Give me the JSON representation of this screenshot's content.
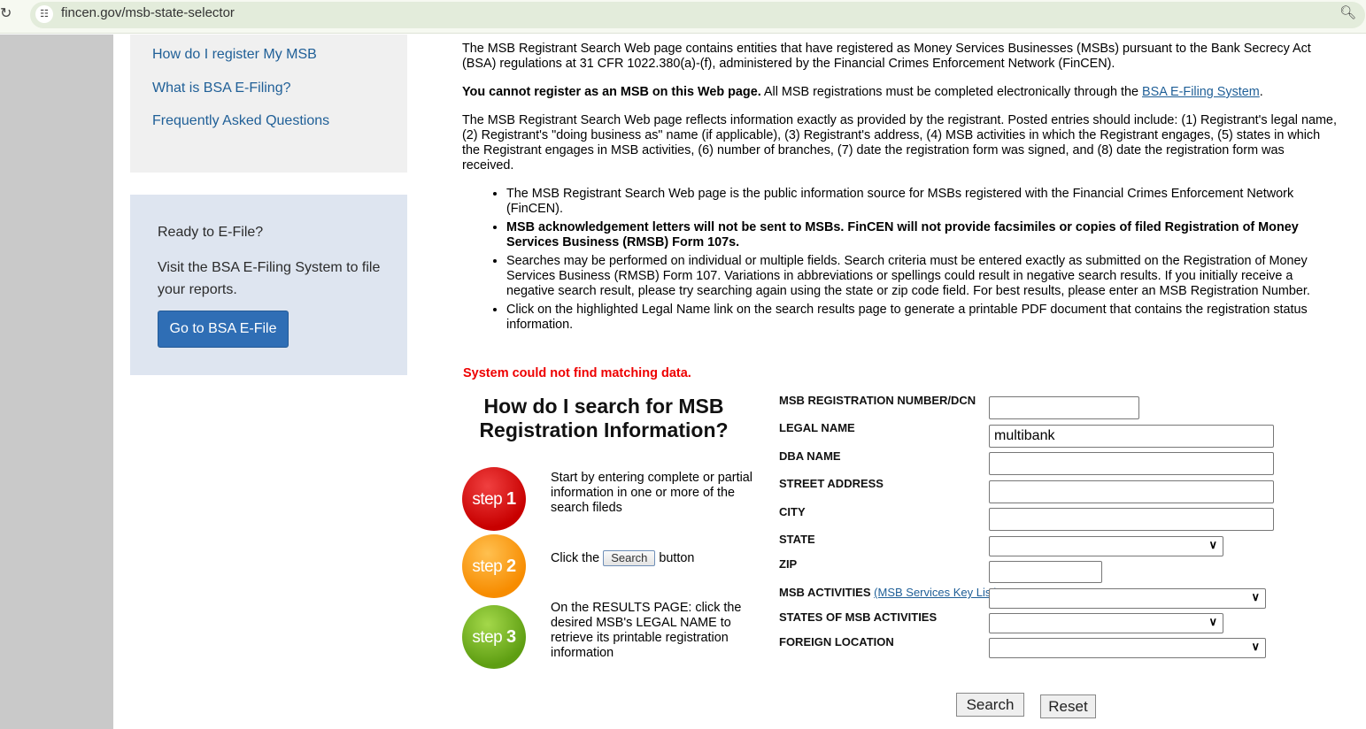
{
  "browser": {
    "url": "fincen.gov/msb-state-selector"
  },
  "sidebar": {
    "links": [
      "How do I register My MSB",
      "What is BSA E-Filing?",
      "Frequently Asked Questions"
    ],
    "efile": {
      "heading": "Ready to E-File?",
      "text": "Visit the BSA E-Filing System to file your reports.",
      "button": "Go to BSA E-File"
    }
  },
  "main": {
    "p1": "The MSB Registrant Search Web page contains entities that have registered as Money Services Businesses (MSBs) pursuant to the Bank Secrecy Act (BSA) regulations at 31 CFR 1022.380(a)-(f), administered by the Financial Crimes Enforcement Network (FinCEN).",
    "p2_bold": "You cannot register as an MSB on this Web page.",
    "p2_text": " All MSB registrations must be completed electronically through the ",
    "p2_link": "BSA E-Filing System",
    "p2_end": ".",
    "p3": "The MSB Registrant Search Web page reflects information exactly as provided by the registrant. Posted entries should include: (1) Registrant's legal name, (2) Registrant's \"doing business as\" name (if applicable), (3) Registrant's address, (4) MSB activities in which the Registrant engages, (5) states in which the Registrant engages in MSB activities, (6) number of branches, (7) date the registration form was signed, and (8) date the registration form was received.",
    "bullets": [
      "The MSB Registrant Search Web page is the public information source for MSBs registered with the Financial Crimes Enforcement Network (FinCEN).",
      "MSB acknowledgement letters will not be sent to MSBs. FinCEN will not provide facsimiles or copies of filed Registration of Money Services Business (RMSB) Form 107s.",
      "Searches may be performed on individual or multiple fields. Search criteria must be entered exactly as submitted on the Registration of Money Services Business (RMSB) Form 107. Variations in abbreviations or spellings could result in negative search results. If you initially receive a negative search result, please try searching again using the state or zip code field. For best results, please enter an MSB Registration Number.",
      "Click on the highlighted Legal Name link on the search results page to generate a printable PDF document that contains the registration status information."
    ]
  },
  "error": "System could not find matching data.",
  "howto": {
    "title": "How do I search for MSB Registration Information?",
    "steps": [
      {
        "word": "step",
        "num": "1",
        "text": "Start by entering complete or partial information in one or more of the search fileds"
      },
      {
        "word": "step",
        "num": "2",
        "pre": "Click the",
        "btn": "Search",
        "post": "button"
      },
      {
        "word": "step",
        "num": "3",
        "text": "On the RESULTS PAGE: click the desired MSB's LEGAL NAME to retrieve its printable registration information"
      }
    ]
  },
  "form": {
    "reg_label": "MSB REGISTRATION NUMBER/DCN",
    "legal_label": "LEGAL NAME",
    "legal_value": "multibank",
    "dba_label": "DBA NAME",
    "street_label": "STREET ADDRESS",
    "city_label": "CITY",
    "state_label": "STATE",
    "zip_label": "ZIP",
    "act_label": "MSB ACTIVITIES",
    "act_link": "(MSB Services Key List)",
    "states_label": "STATES OF MSB ACTIVITIES",
    "foreign_label": "FOREIGN LOCATION",
    "search": "Search",
    "reset": "Reset"
  },
  "colors": {
    "step1": "#d10a0a",
    "step2": "#f7940f",
    "step3": "#6fae1c",
    "link": "#1f5f97",
    "error": "#ee0000"
  }
}
